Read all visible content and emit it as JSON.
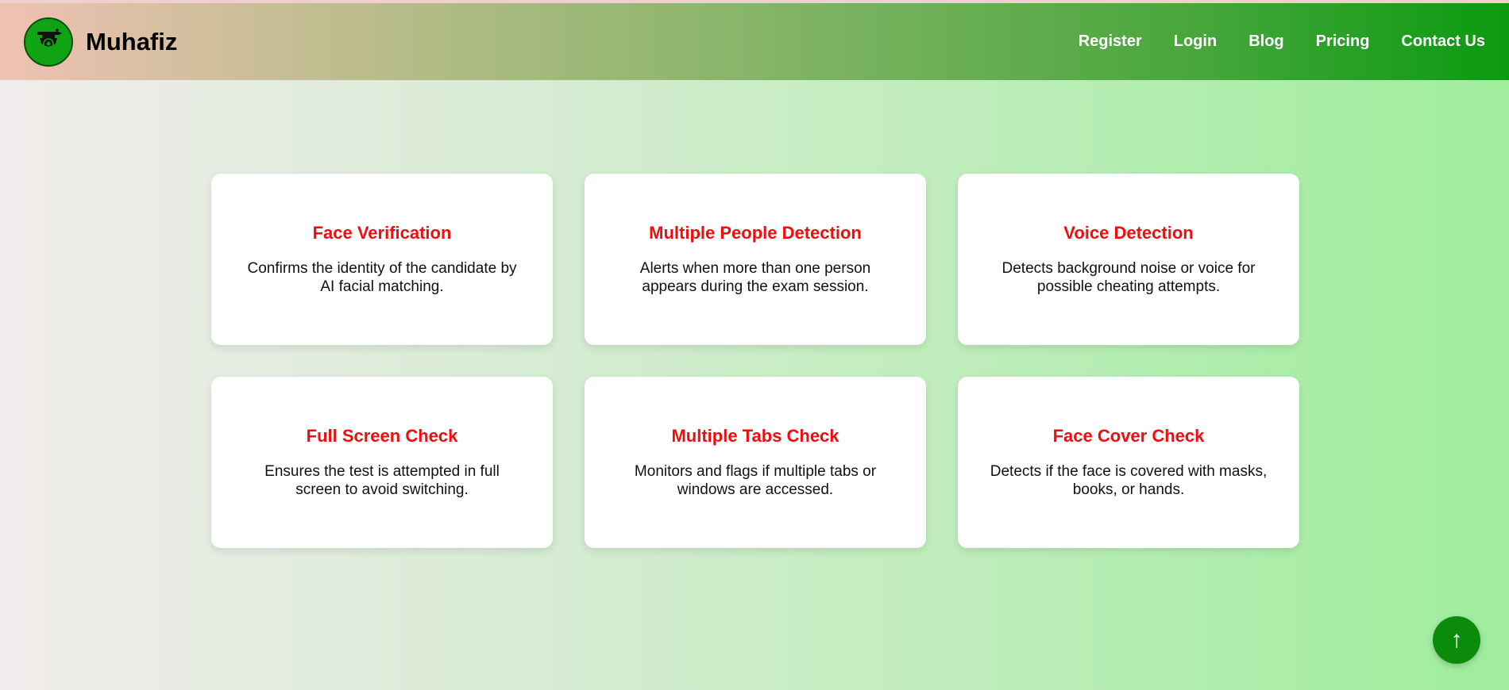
{
  "brand": {
    "name": "Muhafiz",
    "logo_icon": "security-camera-icon"
  },
  "nav": {
    "items": [
      {
        "label": "Register"
      },
      {
        "label": "Login"
      },
      {
        "label": "Blog"
      },
      {
        "label": "Pricing"
      },
      {
        "label": "Contact Us"
      }
    ]
  },
  "features": [
    {
      "title": "Face Verification",
      "description": "Confirms the identity of the candidate by AI facial matching."
    },
    {
      "title": "Multiple People Detection",
      "description": "Alerts when more than one person appears during the exam session."
    },
    {
      "title": "Voice Detection",
      "description": "Detects background noise or voice for possible cheating attempts."
    },
    {
      "title": "Full Screen Check",
      "description": "Ensures the test is attempted in full screen to avoid switching."
    },
    {
      "title": "Multiple Tabs Check",
      "description": "Monitors and flags if multiple tabs or windows are accessed."
    },
    {
      "title": "Face Cover Check",
      "description": "Detects if the face is covered with masks, books, or hands."
    }
  ],
  "back_to_top": {
    "icon": "arrow-up-icon",
    "glyph": "↑"
  },
  "colors": {
    "accent_green": "#0a9a10",
    "feature_title_red": "#f20d0d",
    "card_background": "#ffffff"
  }
}
